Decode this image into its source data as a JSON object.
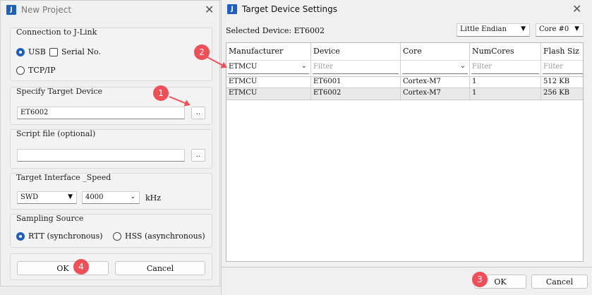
{
  "left_window": {
    "title": "New Project",
    "connection": {
      "label": "Connection to J-Link",
      "usb": "USB",
      "serial": "Serial No.",
      "tcpip": "TCP/IP"
    },
    "target_device": {
      "label": "Specify Target Device",
      "value": "ET6002",
      "browse": ".."
    },
    "script_file": {
      "label": "Script file (optional)",
      "value": "",
      "browse": ".."
    },
    "interface": {
      "label": "Target Interface _Speed",
      "type": "SWD",
      "speed": "4000",
      "unit": "kHz"
    },
    "sampling": {
      "label": "Sampling Source",
      "rtt": "RTT (synchronous)",
      "hss": "HSS (asynchronous)"
    },
    "ok": "OK",
    "cancel": "Cancel"
  },
  "right_window": {
    "title": "Target Device Settings",
    "selected_label": "Selected Device: ET6002",
    "endian": "Little Endian",
    "core": "Core #0",
    "columns": [
      "Manufacturer",
      "Device",
      "Core",
      "NumCores",
      "Flash Siz"
    ],
    "filters": [
      "ETMCU",
      "Filter",
      "",
      "Filter",
      "Filter"
    ],
    "rows": [
      [
        "ETMCU",
        "ET6001",
        "Cortex-M7",
        "1",
        "512 KB"
      ],
      [
        "ETMCU",
        "ET6002",
        "Cortex-M7",
        "1",
        "256 KB"
      ]
    ],
    "ok": "OK",
    "cancel": "Cancel"
  },
  "annotations": [
    "1",
    "2",
    "3",
    "4"
  ],
  "colors": {
    "accent": "#1f5fbf",
    "annotation": "#ef4f57"
  }
}
